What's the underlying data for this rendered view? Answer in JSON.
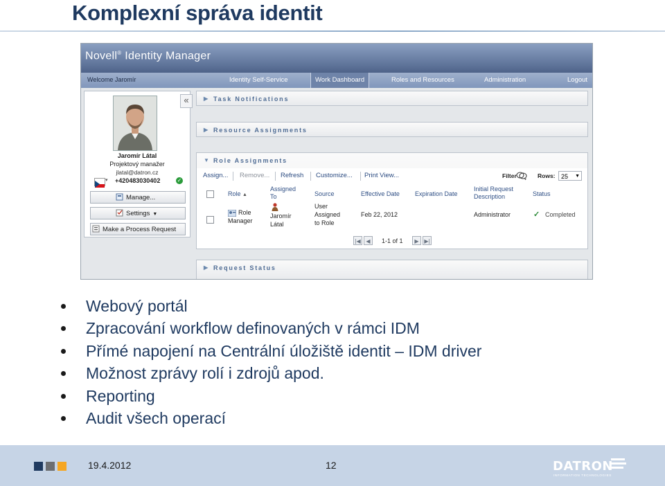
{
  "slide": {
    "title": "Komplexní správa identit"
  },
  "app": {
    "logo_text": "Novell",
    "logo_mark": "®",
    "logo_product": " Identity Manager",
    "welcome": "Welcome Jaromír",
    "nav": [
      "Identity Self-Service",
      "Work Dashboard",
      "Roles and Resources",
      "Administration",
      "Logout"
    ],
    "active_nav": "Work Dashboard"
  },
  "profile": {
    "name": "Jaromír Látal",
    "title": "Projektový manažer",
    "email": "jlatal@datron.cz",
    "phone": "+420483030402",
    "buttons": {
      "manage": "Manage...",
      "settings": "Settings",
      "process": "Make a Process Request"
    }
  },
  "sections": {
    "task": "Task Notifications",
    "resource": "Resource Assignments",
    "role": "Role Assignments",
    "request": "Request Status"
  },
  "toolbar": {
    "assign": "Assign...",
    "remove": "Remove...",
    "refresh": "Refresh",
    "customize": "Customize...",
    "print": "Print View...",
    "filter": "Filter",
    "rows_label": "Rows:",
    "rows_value": "25"
  },
  "table": {
    "headers": {
      "role": "Role",
      "assigned_to_1": "Assigned",
      "assigned_to_2": "To",
      "source": "Source",
      "effective": "Effective Date",
      "expiration": "Expiration Date",
      "initial_1": "Initial Request",
      "initial_2": "Description",
      "status": "Status"
    },
    "row": {
      "role_1": "Role",
      "role_2": "Manager",
      "assigned_1": "Jaromír",
      "assigned_2": "Látal",
      "source_1": "User",
      "source_2": "Assigned",
      "source_3": "to Role",
      "effective": "Feb 22, 2012",
      "initial": "Administrator",
      "status": "Completed"
    },
    "pager": "1-1 of 1"
  },
  "bullets": [
    "Webový portál",
    "Zpracování workflow definovaných v rámci IDM",
    "Přímé napojení na Centrální úložiště identit – IDM driver",
    "Možnost zprávy rolí i zdrojů apod.",
    "Reporting",
    "Audit všech operací"
  ],
  "footer": {
    "date": "19.4.2012",
    "page": "12",
    "logo": "DATRON",
    "logo_sub": "INFORMATION TECHNOLOGIES",
    "square_colors": [
      "#1f3a60",
      "#6d6e71",
      "#f5a623"
    ]
  }
}
